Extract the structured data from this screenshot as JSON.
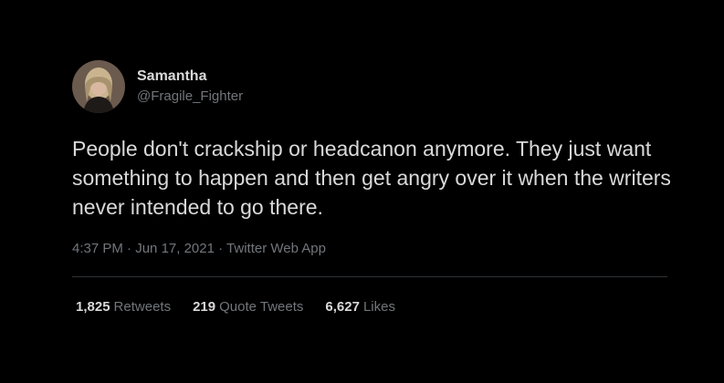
{
  "user": {
    "display_name": "Samantha",
    "handle": "@Fragile_Fighter"
  },
  "tweet": {
    "text": "People don't crackship or headcanon anymore. They just want something to happen and then get angry over it when the writers never intended to go there.",
    "time": "4:37 PM",
    "date": "Jun 17, 2021",
    "source": "Twitter Web App",
    "separator": " · "
  },
  "stats": {
    "retweets": {
      "count": "1,825",
      "label": "Retweets"
    },
    "quote_tweets": {
      "count": "219",
      "label": "Quote Tweets"
    },
    "likes": {
      "count": "6,627",
      "label": "Likes"
    }
  },
  "colors": {
    "background": "#000000",
    "primary_text": "#d9d9d9",
    "secondary_text": "#71767b",
    "divider": "#2f3336"
  }
}
